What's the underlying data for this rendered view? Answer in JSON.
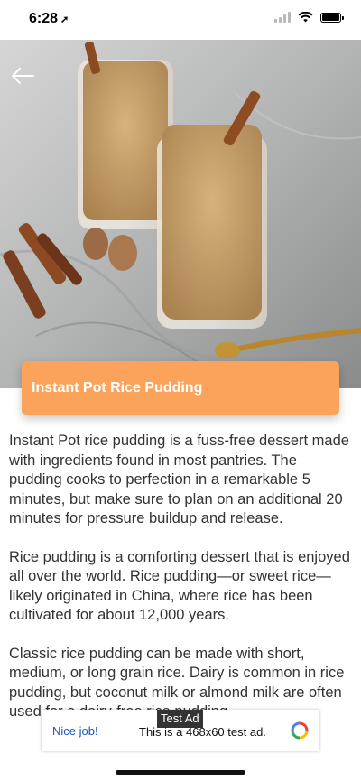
{
  "status_bar": {
    "time": "6:28",
    "location_glyph": "➚"
  },
  "article": {
    "title": "Instant Pot Rice Pudding",
    "paragraphs": [
      "Instant Pot rice pudding is a fuss-free dessert made with ingredients found in most pantries. The pudding cooks to perfection in a remarkable 5 minutes, but make sure to plan on an additional 20 minutes for pressure buildup and release.",
      "Rice pudding is a comforting dessert that is enjoyed all over the world. Rice pudding—or sweet rice—likely originated in China, where rice has been cultivated for about 12,000 years.",
      "Classic rice pudding can be made with short, medium, or long grain rice. Dairy is common in rice pudding, but coconut milk or almond milk are often used for a dairy-free rice pudding."
    ]
  },
  "ad": {
    "label": "Test Ad",
    "nice_job": "Nice job!",
    "text": "This is a 468x60 test ad."
  },
  "icons": {
    "back": "arrow-left-icon",
    "wifi": "wifi-icon",
    "battery": "battery-icon",
    "ad_logo": "ad-choices-logo"
  }
}
